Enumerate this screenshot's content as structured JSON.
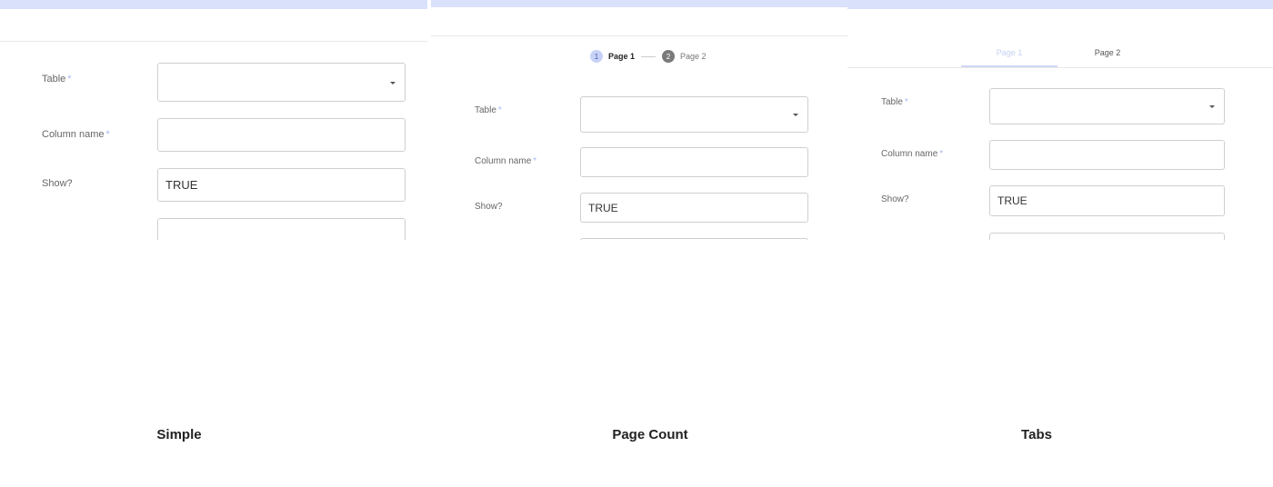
{
  "forms": {
    "fields": {
      "table_label": "Table",
      "column_label": "Column name",
      "show_label": "Show?",
      "required_mark": "*",
      "show_value": "TRUE"
    }
  },
  "page_count": {
    "steps": [
      {
        "number": "1",
        "label": "Page 1"
      },
      {
        "number": "2",
        "label": "Page 2"
      }
    ]
  },
  "tabs": {
    "items": [
      {
        "label": "Page 1"
      },
      {
        "label": "Page 2"
      }
    ]
  },
  "captions": {
    "simple": "Simple",
    "page_count": "Page Count",
    "tabs": "Tabs"
  },
  "colors": {
    "accent": "#aab8ef",
    "header_bar": "#d9e1fb"
  }
}
